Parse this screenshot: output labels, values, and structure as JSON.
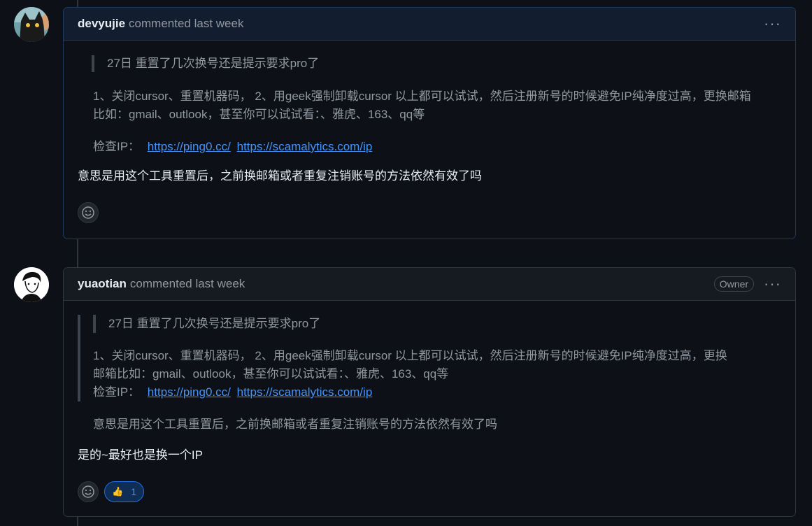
{
  "comments": [
    {
      "author": "devyujie",
      "meta": "commented last week",
      "quote_outer": "27日 重置了几次换号还是提示要求pro了",
      "quote_lines": [
        "1、关闭cursor、重置机器码， 2、用geek强制卸载cursor 以上都可以试试，然后注册新号的时候避免IP纯净度过高，更换邮箱",
        "比如：gmail、outlook，甚至你可以试试看：、雅虎、163、qq等"
      ],
      "check_ip_label": "检查IP：",
      "links": [
        "https://ping0.cc/",
        "https://scamalytics.com/ip"
      ],
      "reply": "意思是用这个工具重置后，之前换邮箱或者重复注销账号的方法依然有效了吗"
    },
    {
      "author": "yuaotian",
      "meta": "commented last week",
      "badge": "Owner",
      "quote_inner": "27日 重置了几次换号还是提示要求pro了",
      "quote_lines": [
        "1、关闭cursor、重置机器码， 2、用geek强制卸载cursor 以上都可以试试，然后注册新号的时候避免IP纯净度过高，更换",
        "邮箱比如：gmail、outlook，甚至你可以试试看：、雅虎、163、qq等"
      ],
      "check_ip_label": "检查IP：",
      "links": [
        "https://ping0.cc/",
        "https://scamalytics.com/ip"
      ],
      "quote_tail": "意思是用这个工具重置后，之前换邮箱或者重复注销账号的方法依然有效了吗",
      "reply": "是的~最好也是换一个IP",
      "reaction": {
        "icon": "thumbs-up",
        "count": "1"
      }
    }
  ],
  "more_icon": "···",
  "colors": {
    "link": "#4493f8",
    "bg": "#0d1117",
    "border": "#30363d"
  }
}
